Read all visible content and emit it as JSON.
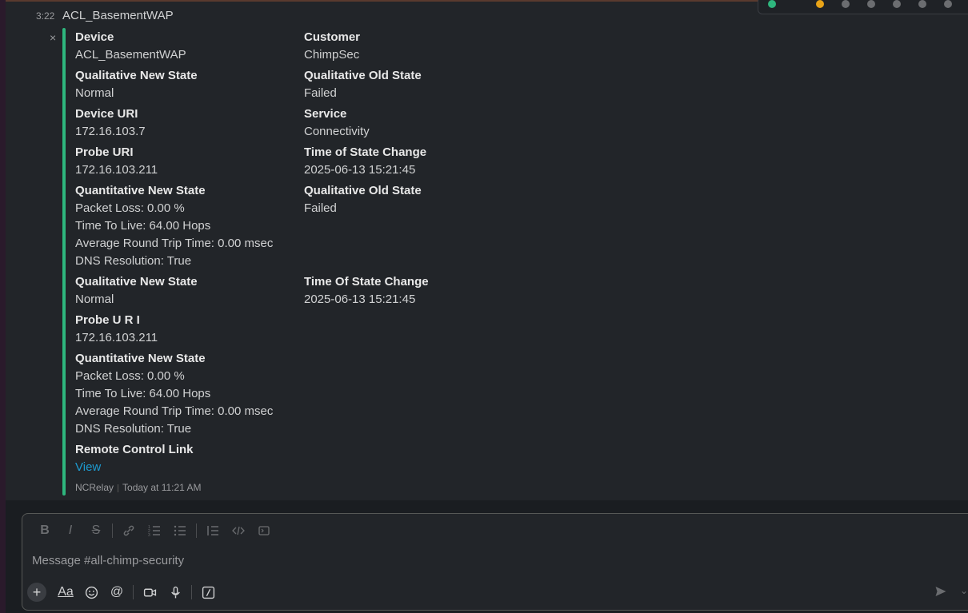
{
  "message": {
    "time": "3:22",
    "title": "ACL_BasementWAP",
    "close_glyph": "×"
  },
  "attachment": {
    "rows": [
      [
        {
          "label": "Device",
          "values": [
            "ACL_BasementWAP"
          ]
        },
        {
          "label": "Customer",
          "values": [
            "ChimpSec"
          ]
        }
      ],
      [
        {
          "label": "Qualitative New State",
          "values": [
            "Normal"
          ]
        },
        {
          "label": "Qualitative Old State",
          "values": [
            "Failed"
          ]
        }
      ],
      [
        {
          "label": "Device URI",
          "values": [
            "172.16.103.7"
          ]
        },
        {
          "label": "Service",
          "values": [
            "Connectivity"
          ]
        }
      ],
      [
        {
          "label": "Probe URI",
          "values": [
            "172.16.103.211"
          ]
        },
        {
          "label": "Time of State Change",
          "values": [
            "2025-06-13 15:21:45"
          ]
        }
      ],
      [
        {
          "label": "Quantitative New State",
          "values": [
            "Packet Loss: 0.00 %",
            "Time To Live: 64.00 Hops",
            "Average Round Trip Time: 0.00 msec",
            "DNS Resolution: True"
          ]
        },
        {
          "label": "Qualitative Old State",
          "values": [
            "Failed"
          ]
        }
      ],
      [
        {
          "label": "Qualitative New State",
          "values": [
            "Normal"
          ]
        },
        {
          "label": "Time Of State Change",
          "values": [
            "2025-06-13 15:21:45"
          ]
        }
      ],
      [
        {
          "label": "Probe U R I",
          "values": [
            "172.16.103.211"
          ]
        }
      ],
      [
        {
          "label": "Quantitative New State",
          "values": [
            "Packet Loss: 0.00 %",
            "Time To Live: 64.00 Hops",
            "Average Round Trip Time: 0.00 msec",
            "DNS Resolution: True"
          ]
        }
      ],
      [
        {
          "label": "Remote Control Link",
          "link": "View"
        }
      ]
    ],
    "footer_app": "NCRelay",
    "footer_time": "Today at 11:21 AM",
    "accent_color": "#2eb67d"
  },
  "composer": {
    "placeholder": "Message #all-chimp-security",
    "format_buttons": [
      "bold-icon",
      "italic-icon",
      "strikethrough-icon",
      "link-icon",
      "ordered-list-icon",
      "bulleted-list-icon",
      "blockquote-icon",
      "code-icon",
      "code-block-icon"
    ],
    "bottom_buttons": [
      "plus-icon",
      "formatting-icon",
      "emoji-icon",
      "mention-icon",
      "video-icon",
      "microphone-icon",
      "slash-command-icon"
    ],
    "send_icon": "send-icon"
  }
}
